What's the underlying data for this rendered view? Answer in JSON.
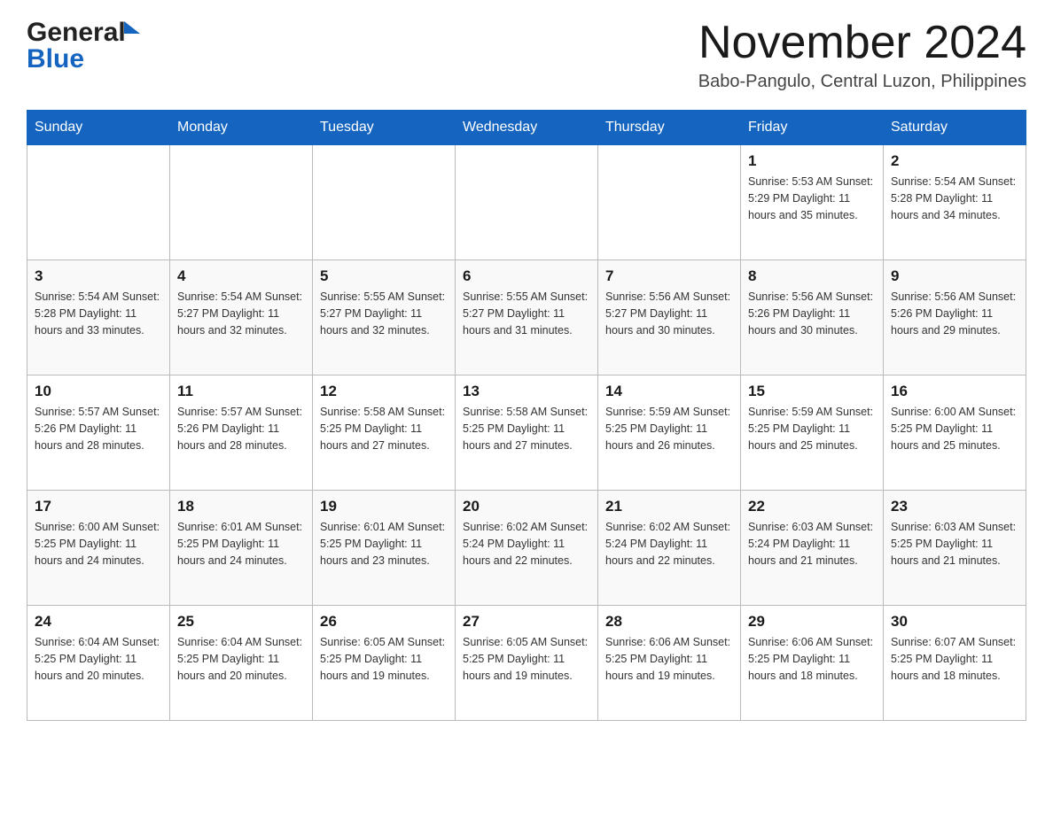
{
  "header": {
    "logo": {
      "general_text": "General",
      "blue_text": "Blue"
    },
    "title": "November 2024",
    "location": "Babo-Pangulo, Central Luzon, Philippines"
  },
  "calendar": {
    "days_of_week": [
      "Sunday",
      "Monday",
      "Tuesday",
      "Wednesday",
      "Thursday",
      "Friday",
      "Saturday"
    ],
    "weeks": [
      {
        "days": [
          {
            "num": "",
            "info": ""
          },
          {
            "num": "",
            "info": ""
          },
          {
            "num": "",
            "info": ""
          },
          {
            "num": "",
            "info": ""
          },
          {
            "num": "",
            "info": ""
          },
          {
            "num": "1",
            "info": "Sunrise: 5:53 AM\nSunset: 5:29 PM\nDaylight: 11 hours\nand 35 minutes."
          },
          {
            "num": "2",
            "info": "Sunrise: 5:54 AM\nSunset: 5:28 PM\nDaylight: 11 hours\nand 34 minutes."
          }
        ]
      },
      {
        "days": [
          {
            "num": "3",
            "info": "Sunrise: 5:54 AM\nSunset: 5:28 PM\nDaylight: 11 hours\nand 33 minutes."
          },
          {
            "num": "4",
            "info": "Sunrise: 5:54 AM\nSunset: 5:27 PM\nDaylight: 11 hours\nand 32 minutes."
          },
          {
            "num": "5",
            "info": "Sunrise: 5:55 AM\nSunset: 5:27 PM\nDaylight: 11 hours\nand 32 minutes."
          },
          {
            "num": "6",
            "info": "Sunrise: 5:55 AM\nSunset: 5:27 PM\nDaylight: 11 hours\nand 31 minutes."
          },
          {
            "num": "7",
            "info": "Sunrise: 5:56 AM\nSunset: 5:27 PM\nDaylight: 11 hours\nand 30 minutes."
          },
          {
            "num": "8",
            "info": "Sunrise: 5:56 AM\nSunset: 5:26 PM\nDaylight: 11 hours\nand 30 minutes."
          },
          {
            "num": "9",
            "info": "Sunrise: 5:56 AM\nSunset: 5:26 PM\nDaylight: 11 hours\nand 29 minutes."
          }
        ]
      },
      {
        "days": [
          {
            "num": "10",
            "info": "Sunrise: 5:57 AM\nSunset: 5:26 PM\nDaylight: 11 hours\nand 28 minutes."
          },
          {
            "num": "11",
            "info": "Sunrise: 5:57 AM\nSunset: 5:26 PM\nDaylight: 11 hours\nand 28 minutes."
          },
          {
            "num": "12",
            "info": "Sunrise: 5:58 AM\nSunset: 5:25 PM\nDaylight: 11 hours\nand 27 minutes."
          },
          {
            "num": "13",
            "info": "Sunrise: 5:58 AM\nSunset: 5:25 PM\nDaylight: 11 hours\nand 27 minutes."
          },
          {
            "num": "14",
            "info": "Sunrise: 5:59 AM\nSunset: 5:25 PM\nDaylight: 11 hours\nand 26 minutes."
          },
          {
            "num": "15",
            "info": "Sunrise: 5:59 AM\nSunset: 5:25 PM\nDaylight: 11 hours\nand 25 minutes."
          },
          {
            "num": "16",
            "info": "Sunrise: 6:00 AM\nSunset: 5:25 PM\nDaylight: 11 hours\nand 25 minutes."
          }
        ]
      },
      {
        "days": [
          {
            "num": "17",
            "info": "Sunrise: 6:00 AM\nSunset: 5:25 PM\nDaylight: 11 hours\nand 24 minutes."
          },
          {
            "num": "18",
            "info": "Sunrise: 6:01 AM\nSunset: 5:25 PM\nDaylight: 11 hours\nand 24 minutes."
          },
          {
            "num": "19",
            "info": "Sunrise: 6:01 AM\nSunset: 5:25 PM\nDaylight: 11 hours\nand 23 minutes."
          },
          {
            "num": "20",
            "info": "Sunrise: 6:02 AM\nSunset: 5:24 PM\nDaylight: 11 hours\nand 22 minutes."
          },
          {
            "num": "21",
            "info": "Sunrise: 6:02 AM\nSunset: 5:24 PM\nDaylight: 11 hours\nand 22 minutes."
          },
          {
            "num": "22",
            "info": "Sunrise: 6:03 AM\nSunset: 5:24 PM\nDaylight: 11 hours\nand 21 minutes."
          },
          {
            "num": "23",
            "info": "Sunrise: 6:03 AM\nSunset: 5:25 PM\nDaylight: 11 hours\nand 21 minutes."
          }
        ]
      },
      {
        "days": [
          {
            "num": "24",
            "info": "Sunrise: 6:04 AM\nSunset: 5:25 PM\nDaylight: 11 hours\nand 20 minutes."
          },
          {
            "num": "25",
            "info": "Sunrise: 6:04 AM\nSunset: 5:25 PM\nDaylight: 11 hours\nand 20 minutes."
          },
          {
            "num": "26",
            "info": "Sunrise: 6:05 AM\nSunset: 5:25 PM\nDaylight: 11 hours\nand 19 minutes."
          },
          {
            "num": "27",
            "info": "Sunrise: 6:05 AM\nSunset: 5:25 PM\nDaylight: 11 hours\nand 19 minutes."
          },
          {
            "num": "28",
            "info": "Sunrise: 6:06 AM\nSunset: 5:25 PM\nDaylight: 11 hours\nand 19 minutes."
          },
          {
            "num": "29",
            "info": "Sunrise: 6:06 AM\nSunset: 5:25 PM\nDaylight: 11 hours\nand 18 minutes."
          },
          {
            "num": "30",
            "info": "Sunrise: 6:07 AM\nSunset: 5:25 PM\nDaylight: 11 hours\nand 18 minutes."
          }
        ]
      }
    ]
  }
}
